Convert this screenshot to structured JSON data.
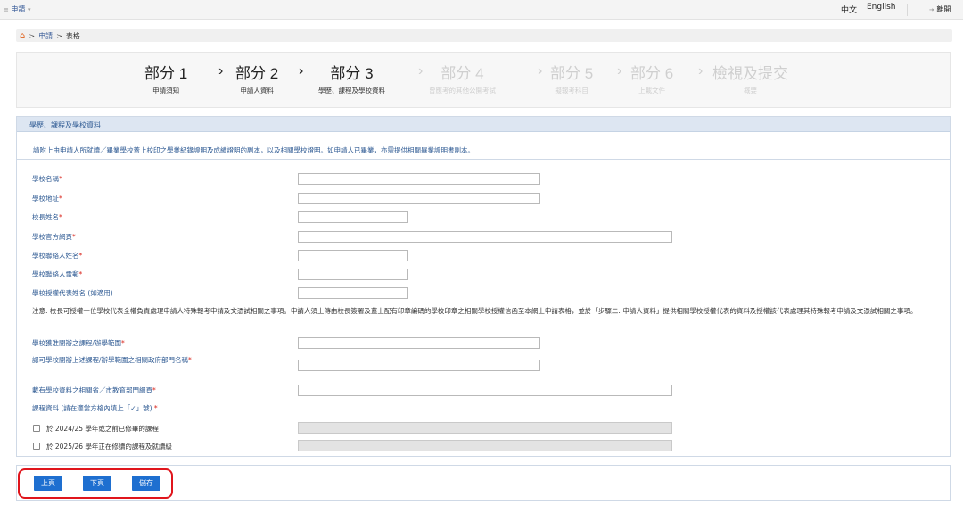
{
  "topbar": {
    "menu_label": "申請",
    "lang_zh": "中文",
    "lang_en": "English",
    "logout_label": "離開"
  },
  "breadcrumb": {
    "items": [
      "申請",
      "表格"
    ],
    "separator": ">"
  },
  "steps": [
    {
      "title": "部分 1",
      "subtitle": "申請須知",
      "state": "done"
    },
    {
      "title": "部分 2",
      "subtitle": "申請人資料",
      "state": "done"
    },
    {
      "title": "部分 3",
      "subtitle": "學歷、課程及學校資料",
      "state": "current"
    },
    {
      "title": "部分 4",
      "subtitle": "曾應考的其他公開考試",
      "state": "upcoming"
    },
    {
      "title": "部分 5",
      "subtitle": "擬報考科目",
      "state": "upcoming"
    },
    {
      "title": "部分 6",
      "subtitle": "上載文件",
      "state": "upcoming"
    },
    {
      "title": "檢視及提交",
      "subtitle": "概要",
      "state": "upcoming"
    }
  ],
  "panel": {
    "title": "學歷、課程及學校資料",
    "notice": "請附上由申請人所就讀／畢業學校蓋上校印之學業紀錄證明及成績證明的副本，以及相關學校證明。如申請人已畢業，亦需提供相關畢業證明書副本。"
  },
  "fields": [
    {
      "label": "學校名稱",
      "required": true,
      "value": ""
    },
    {
      "label": "學校地址",
      "required": true,
      "value": ""
    },
    {
      "label": "校長姓名",
      "required": true,
      "value": ""
    },
    {
      "label": "學校官方網頁",
      "required": true,
      "value": ""
    },
    {
      "label": "學校聯絡人姓名",
      "required": true,
      "value": ""
    },
    {
      "label": "學校聯絡人電郵",
      "required": true,
      "value": ""
    },
    {
      "label": "學校授權代表姓名 (如適用)",
      "required": false,
      "value": ""
    },
    {
      "label": "學校獲准開辦之課程/辦學範圍",
      "required": true,
      "value": ""
    },
    {
      "label": "認可學校開辦上述課程/辦學範圍之相關政府部門名稱",
      "required": true,
      "value": ""
    },
    {
      "label": "載有學校資料之相關省／市教育部門網頁",
      "required": true,
      "value": ""
    }
  ],
  "note": "注意: 校長可授權一位學校代表全權負責處理申請人特殊報考申請及文憑試相關之事項。申請人須上傳由校長簽署及蓋上配有印章編碼的學校印章之相關學校授權信函至本網上申請表格，並於「步驟二: 申請人資料」提供相關學校授權代表的資料及授權該代表處理其特殊報考申請及文憑試相關之事項。",
  "course_section": {
    "label": "課程資料 (請在適當方格內填上「✓」號)",
    "required": true,
    "options": [
      {
        "label": "於 2024/25 學年或之前已修畢的課程",
        "checked": false,
        "value": ""
      },
      {
        "label": "於 2025/26 學年正在修讀的課程及就讀級",
        "checked": false,
        "value": ""
      }
    ]
  },
  "buttons": {
    "prev": "上頁",
    "next": "下頁",
    "save": "儲存"
  },
  "colors": {
    "link": "#2e5a93",
    "required": "#d9251c",
    "button": "#1e6fd0",
    "highlight_ring": "#e0151c",
    "panel_header": "#dde6f2"
  }
}
